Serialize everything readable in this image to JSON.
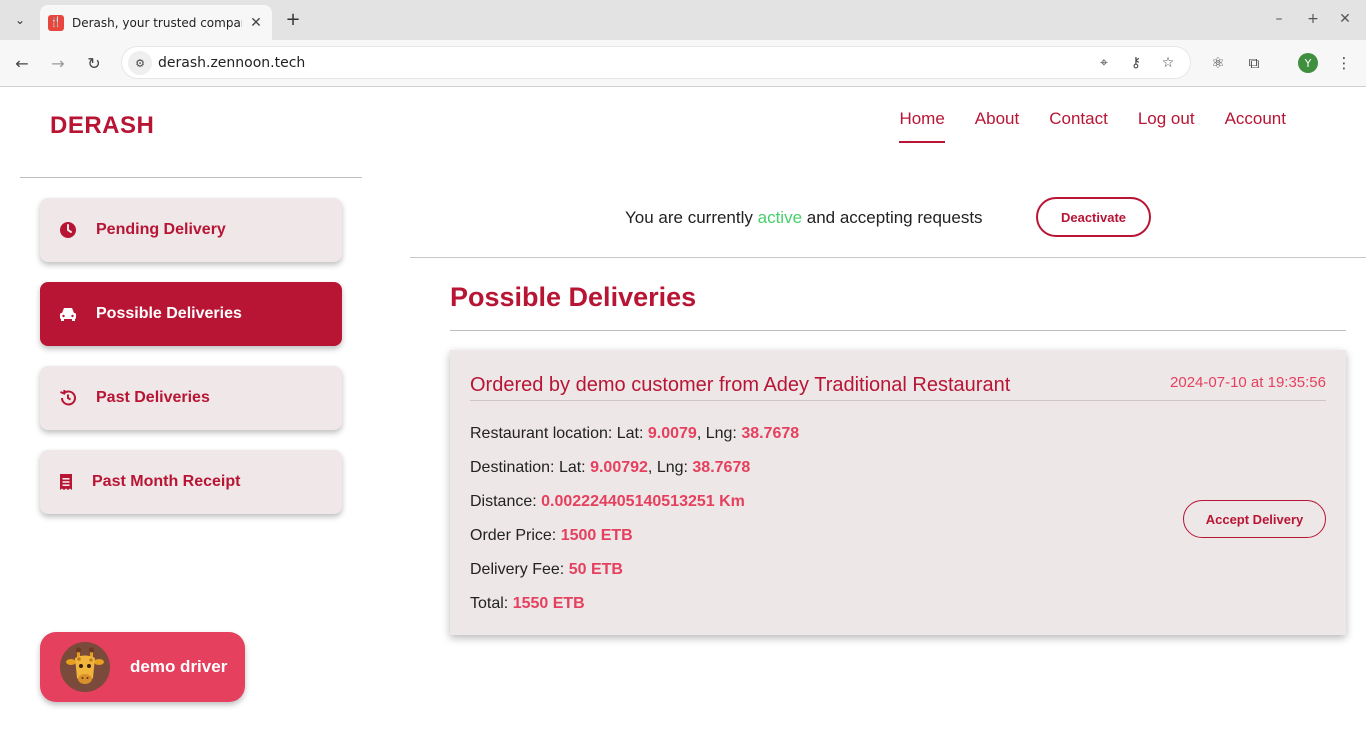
{
  "browser": {
    "tab_title": "Derash, your trusted companion",
    "url": "derash.zennoon.tech",
    "profile_initial": "Y"
  },
  "brand": "DERASH",
  "nav": [
    {
      "label": "Home",
      "active": true
    },
    {
      "label": "About"
    },
    {
      "label": "Contact"
    },
    {
      "label": "Log out"
    },
    {
      "label": "Account"
    }
  ],
  "sidebar": {
    "items": [
      {
        "label": "Pending Delivery",
        "icon": "clock-icon"
      },
      {
        "label": "Possible Deliveries",
        "icon": "car-icon",
        "active": true
      },
      {
        "label": "Past Deliveries",
        "icon": "history-icon"
      },
      {
        "label": "Past Month Receipt",
        "icon": "receipt-icon"
      }
    ],
    "user": {
      "name": "demo driver",
      "avatar": "giraffe-avatar"
    }
  },
  "status": {
    "prefix": "You are currently ",
    "state": "active",
    "suffix": " and accepting requests",
    "button": "Deactivate"
  },
  "section_title": "Possible Deliveries",
  "delivery": {
    "title": "Ordered by demo customer from Adey Traditional Restaurant",
    "date": "2024-07-10 at 19:35:56",
    "restaurant_label": "Restaurant location: Lat: ",
    "restaurant_lat": "9.0079",
    "restaurant_lng_label": ", Lng: ",
    "restaurant_lng": "38.7678",
    "destination_label": "Destination: Lat: ",
    "destination_lat": "9.00792",
    "destination_lng_label": ", Lng: ",
    "destination_lng": "38.7678",
    "distance_label": "Distance: ",
    "distance": "0.002224405140513251 Km",
    "price_label": "Order Price: ",
    "price": "1500 ETB",
    "fee_label": "Delivery Fee: ",
    "fee": "50 ETB",
    "total_label": "Total: ",
    "total": "1550 ETB",
    "accept_button": "Accept Delivery"
  },
  "colors": {
    "brand": "#b81535",
    "accent": "#e5405e",
    "active_status": "#46d06a"
  }
}
